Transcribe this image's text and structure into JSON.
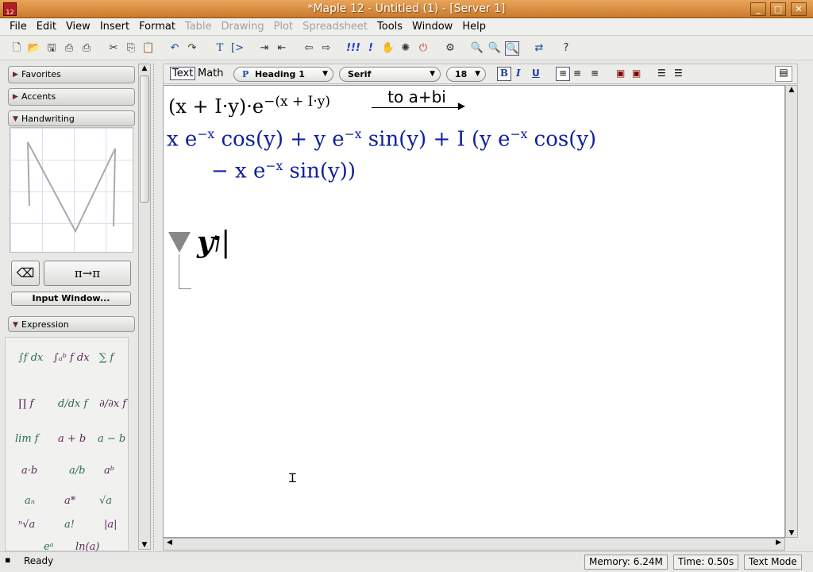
{
  "window": {
    "title": "*Maple 12 - Untitled (1) - [Server 1]",
    "app_icon_label": "12"
  },
  "menu": [
    {
      "label": "File",
      "enabled": true
    },
    {
      "label": "Edit",
      "enabled": true
    },
    {
      "label": "View",
      "enabled": true
    },
    {
      "label": "Insert",
      "enabled": true
    },
    {
      "label": "Format",
      "enabled": true
    },
    {
      "label": "Table",
      "enabled": false
    },
    {
      "label": "Drawing",
      "enabled": false
    },
    {
      "label": "Plot",
      "enabled": false
    },
    {
      "label": "Spreadsheet",
      "enabled": false
    },
    {
      "label": "Tools",
      "enabled": true
    },
    {
      "label": "Window",
      "enabled": true
    },
    {
      "label": "Help",
      "enabled": true
    }
  ],
  "palettes": {
    "favorites": "Favorites",
    "accents": "Accents",
    "handwriting": "Handwriting",
    "input_window": "Input Window...",
    "expression": "Expression",
    "convert_button": "π→π"
  },
  "expressions": [
    "∫f dx",
    "∫ₐᵇ f dx",
    "∑ f",
    "∏ f",
    "d/dx f",
    "∂/∂x f",
    "lim f",
    "a + b",
    "a − b",
    "a·b",
    "a/b",
    "aᵇ",
    "aₙ",
    "a*",
    "√a",
    "ⁿ√a",
    "a!",
    "|a|",
    "eᵃ",
    "ln(a)"
  ],
  "formatbar": {
    "text_mode": "Text",
    "math_mode": "Math",
    "style": "Heading 1",
    "style_prefix": "P",
    "font": "Serif",
    "size": "18",
    "bold": "B",
    "italic": "I",
    "underline": "U"
  },
  "document": {
    "input_lhs": "(x + I·y)·e",
    "input_exp": "−(x + I·y)",
    "arrow_label": "to a+bi",
    "output_line1": "x e<sup>−x</sup> cos(y) + y e<sup>−x</sup> sin(y) + I (y e<sup>−x</sup> cos(y)",
    "output_line2": "− x e<sup>−x</sup> sin(y))",
    "heading_text": "yו"
  },
  "status": {
    "state": "Ready",
    "memory": "Memory: 6.24M",
    "time": "Time: 0.50s",
    "mode": "Text Mode"
  }
}
